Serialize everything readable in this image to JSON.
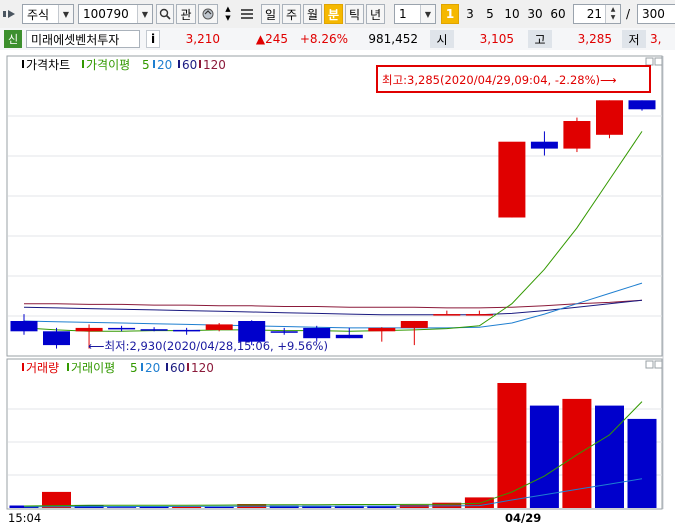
{
  "toolbar": {
    "market_type": "주식",
    "stock_code": "100790",
    "btn_gwan": "관",
    "periods": [
      "일",
      "주",
      "월",
      "분",
      "틱",
      "년"
    ],
    "active_period": "분",
    "interval_value": "1",
    "minute_options": [
      "1",
      "3",
      "5",
      "10",
      "30",
      "60"
    ],
    "active_minute": "1",
    "count_value": "21",
    "separator": "/",
    "total_value": "300"
  },
  "infobar": {
    "badge": "신",
    "stock_name": "미래에셋벤처투자",
    "info_icon": "i",
    "price": "3,210",
    "change": "▲245",
    "change_pct": "+8.26%",
    "volume": "981,452",
    "open_label": "시",
    "open_value": "3,105",
    "high_label": "고",
    "high_value": "3,285",
    "low_label": "저",
    "low_value": "3,"
  },
  "colors": {
    "up": "#e00000",
    "down": "#0000cc",
    "ma5": "#339900",
    "ma20": "#1f7fd0",
    "ma60": "#1a1a80",
    "ma120": "#8b1a3a",
    "annotation_box": "#e00000"
  },
  "price_panel": {
    "legend": {
      "title": "가격차트",
      "ma_label": "가격이평",
      "ma5": "5",
      "ma20": "20",
      "ma60": "60",
      "ma120": "120"
    },
    "high_annotation": "최고:3,285(2020/04/29,09:04, -2.28%)⟶",
    "low_annotation": "⟵최저:2,930(2020/04/28,15:06, +9.56%)"
  },
  "volume_panel": {
    "legend": {
      "title": "거래량",
      "ma_label": "거래이평",
      "ma5": "5",
      "ma20": "20",
      "ma60": "60",
      "ma120": "120"
    }
  },
  "x_axis": {
    "left_label": "15:04",
    "date_label": "04/29"
  },
  "chart_data": [
    {
      "type": "candlestick",
      "title": "가격차트",
      "candles": [
        {
          "o": 2965,
          "h": 2975,
          "l": 2945,
          "c": 2950
        },
        {
          "o": 2950,
          "h": 2955,
          "l": 2925,
          "c": 2930
        },
        {
          "o": 2950,
          "h": 2960,
          "l": 2925,
          "c": 2955
        },
        {
          "o": 2955,
          "h": 2958,
          "l": 2950,
          "c": 2954
        },
        {
          "o": 2953,
          "h": 2956,
          "l": 2950,
          "c": 2952
        },
        {
          "o": 2952,
          "h": 2955,
          "l": 2945,
          "c": 2950
        },
        {
          "o": 2952,
          "h": 2962,
          "l": 2950,
          "c": 2960
        },
        {
          "o": 2965,
          "h": 2966,
          "l": 2930,
          "c": 2935
        },
        {
          "o": 2950,
          "h": 2955,
          "l": 2945,
          "c": 2949
        },
        {
          "o": 2955,
          "h": 2958,
          "l": 2935,
          "c": 2940
        },
        {
          "o": 2945,
          "h": 2955,
          "l": 2940,
          "c": 2940
        },
        {
          "o": 2950,
          "h": 2956,
          "l": 2935,
          "c": 2955
        },
        {
          "o": 2955,
          "h": 2965,
          "l": 2930,
          "c": 2965
        },
        {
          "o": 2975,
          "h": 2980,
          "l": 2975,
          "c": 2975
        },
        {
          "o": 2975,
          "h": 2980,
          "l": 2975,
          "c": 2975
        },
        {
          "o": 3115,
          "h": 3125,
          "l": 3115,
          "c": 3225
        },
        {
          "o": 3225,
          "h": 3240,
          "l": 3205,
          "c": 3215
        },
        {
          "o": 3215,
          "h": 3260,
          "l": 3210,
          "c": 3255
        },
        {
          "o": 3235,
          "h": 3285,
          "l": 3230,
          "c": 3285
        },
        {
          "o": 3285,
          "h": 3285,
          "l": 3270,
          "c": 3272
        }
      ],
      "ma5": [
        2955,
        2952,
        2950,
        2950,
        2951,
        2951,
        2952,
        2952,
        2951,
        2951,
        2950,
        2951,
        2952,
        2954,
        2958,
        2990,
        3040,
        3100,
        3170,
        3240
      ],
      "ma20": [
        2965,
        2964,
        2963,
        2962,
        2961,
        2960,
        2959,
        2958,
        2957,
        2956,
        2955,
        2955,
        2955,
        2955,
        2956,
        2962,
        2975,
        2990,
        3005,
        3020
      ],
      "ma60": [
        2985,
        2984,
        2983,
        2982,
        2981,
        2980,
        2979,
        2978,
        2977,
        2976,
        2975,
        2974,
        2974,
        2974,
        2974,
        2976,
        2980,
        2985,
        2990,
        2995
      ],
      "ma120": [
        2990,
        2990,
        2989,
        2989,
        2988,
        2988,
        2987,
        2987,
        2986,
        2986,
        2985,
        2985,
        2985,
        2984,
        2984,
        2985,
        2987,
        2990,
        2992,
        2995
      ],
      "ylim": [
        2920,
        3300
      ]
    },
    {
      "type": "bar",
      "title": "거래량",
      "values": [
        1900,
        12100,
        2200,
        600,
        900,
        1000,
        800,
        3000,
        1800,
        1700,
        1700,
        1800,
        2300,
        4000,
        8000,
        94000,
        77000,
        82000,
        77000,
        67000
      ],
      "up_flags": [
        false,
        true,
        false,
        false,
        false,
        true,
        false,
        true,
        false,
        false,
        false,
        false,
        true,
        true,
        true,
        true,
        false,
        true,
        false,
        false
      ],
      "ma5": [
        1500,
        1800,
        2000,
        2000,
        2100,
        2100,
        2200,
        2300,
        2400,
        2500,
        2600,
        2600,
        2700,
        2800,
        3500,
        12000,
        24000,
        40000,
        55000,
        80000
      ],
      "ma20": [
        1000,
        1000,
        1050,
        1100,
        1150,
        1200,
        1250,
        1300,
        1300,
        1350,
        1400,
        1450,
        1500,
        1600,
        1800,
        6000,
        10000,
        14000,
        18000,
        22000
      ],
      "ylim": [
        0,
        100000
      ]
    }
  ]
}
